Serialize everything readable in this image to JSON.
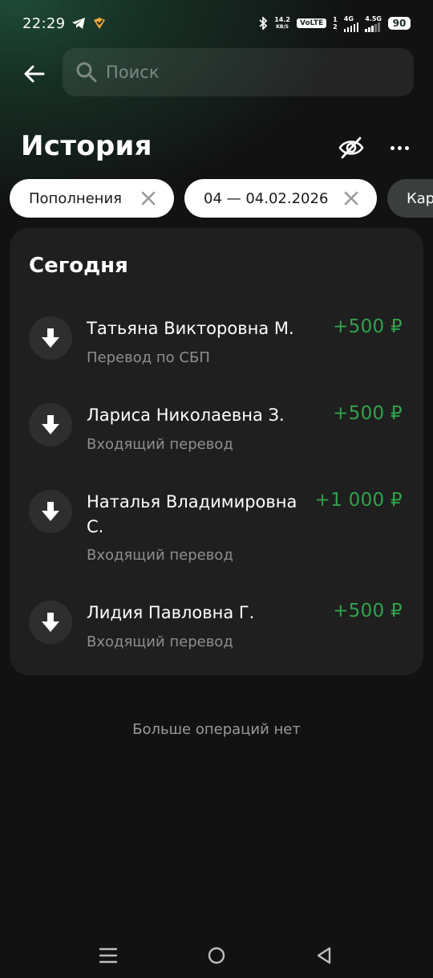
{
  "status_bar": {
    "time": "22:29",
    "net_speed_value": "14.2",
    "net_speed_unit": "KB/S",
    "volte": "VoLTE",
    "sim_top": "1",
    "sim_bottom": "2",
    "network1": "4G",
    "network2": "4.5G",
    "battery": "90"
  },
  "search": {
    "placeholder": "Поиск"
  },
  "page": {
    "title": "История"
  },
  "filters": [
    {
      "label": "Пополнения"
    },
    {
      "label": "04 — 04.02.2026"
    },
    {
      "label": "Кар"
    }
  ],
  "section": {
    "title": "Сегодня"
  },
  "transactions": [
    {
      "name": "Татьяна Викторовна М.",
      "subtitle": "Перевод по СБП",
      "amount": "+500 ₽"
    },
    {
      "name": "Лариса Николаевна З.",
      "subtitle": "Входящий перевод",
      "amount": "+500 ₽"
    },
    {
      "name": "Наталья Владимировна С.",
      "subtitle": "Входящий перевод",
      "amount": "+1 000 ₽"
    },
    {
      "name": "Лидия Павловна Г.",
      "subtitle": "Входящий перевод",
      "amount": "+500 ₽"
    }
  ],
  "footer_note": "Больше операций нет",
  "colors": {
    "background": "#121212",
    "card": "#1f1f1f",
    "accent_green": "#31a24c",
    "chip_light": "#ffffff",
    "chip_dark": "#3a3e3c"
  }
}
